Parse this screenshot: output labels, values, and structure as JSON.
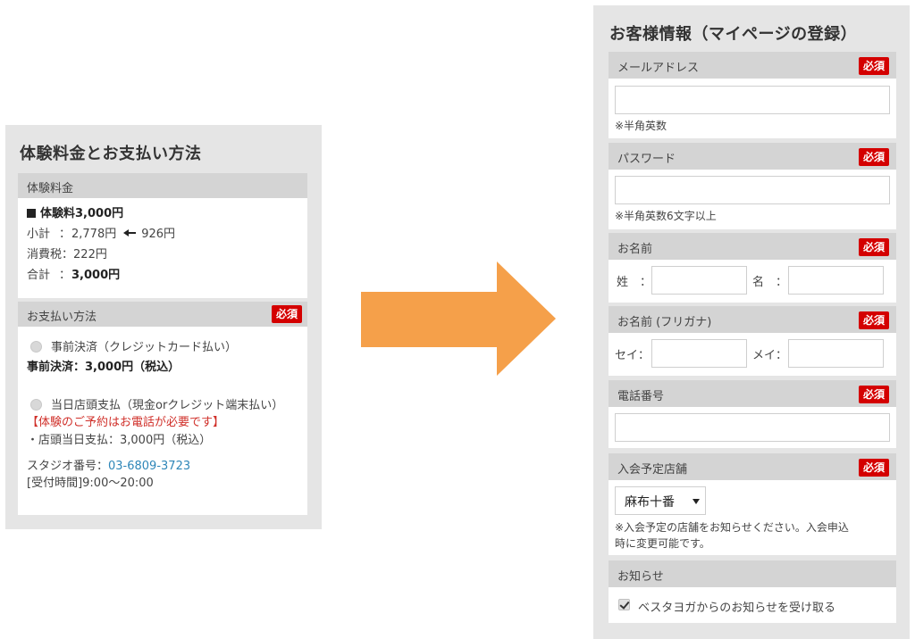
{
  "left_panel": {
    "title": "体験料金とお支払い方法",
    "fee_section": {
      "header": "体験料金",
      "fee_title": "体験料3,000円",
      "subtotal_label": "小計",
      "subtotal_value": "2,778円",
      "subtotal_extra": "926円",
      "tax_label": "消費税",
      "tax_value": "222円",
      "total_label": "合計",
      "total_value": "3,000円"
    },
    "payment_section": {
      "header": "お支払い方法",
      "required_badge": "必須",
      "option1_label": "事前決済（クレジットカード払い）",
      "option1_detail": "事前決済：3,000円（税込）",
      "option2_label": "当日店頭支払（現金orクレジット端末払い）",
      "option2_notice": "【体験のご予約はお電話が必要です】",
      "option2_detail": "・店頭当日支払：3,000円（税込）",
      "studio_label": "スタジオ番号：",
      "studio_phone": "03-6809-3723",
      "hours": "[受付時間]9:00～20:00"
    }
  },
  "arrow": {
    "color": "#f5a04a"
  },
  "right_panel": {
    "title": "お客様情報（マイページの登録）",
    "required_badge": "必須",
    "email": {
      "label": "メールアドレス",
      "value": "",
      "note": "※半角英数"
    },
    "password": {
      "label": "パスワード",
      "value": "",
      "note": "※半角英数6文字以上"
    },
    "name": {
      "label": "お名前",
      "last_label": "姓",
      "first_label": "名",
      "last_value": "",
      "first_value": ""
    },
    "kana": {
      "label": "お名前 (フリガナ)",
      "last_label": "セイ",
      "first_label": "メイ",
      "last_value": "",
      "first_value": ""
    },
    "phone": {
      "label": "電話番号",
      "value": ""
    },
    "store": {
      "label": "入会予定店舗",
      "selected": "麻布十番",
      "note_line1": "※入会予定の店舗をお知らせください。入会申込",
      "note_line2": "時に変更可能です。"
    },
    "newsletter": {
      "label": "お知らせ",
      "checkbox_label": "ベスタヨガからのお知らせを受け取る",
      "checked": true
    }
  },
  "colors": {
    "panel_bg": "#e5e5e5",
    "section_header_bg": "#d4d4d4",
    "required_badge": "#d40000",
    "notice_red": "#d0302a",
    "phone_link": "#2e86b8",
    "arrow": "#f5a04a"
  }
}
